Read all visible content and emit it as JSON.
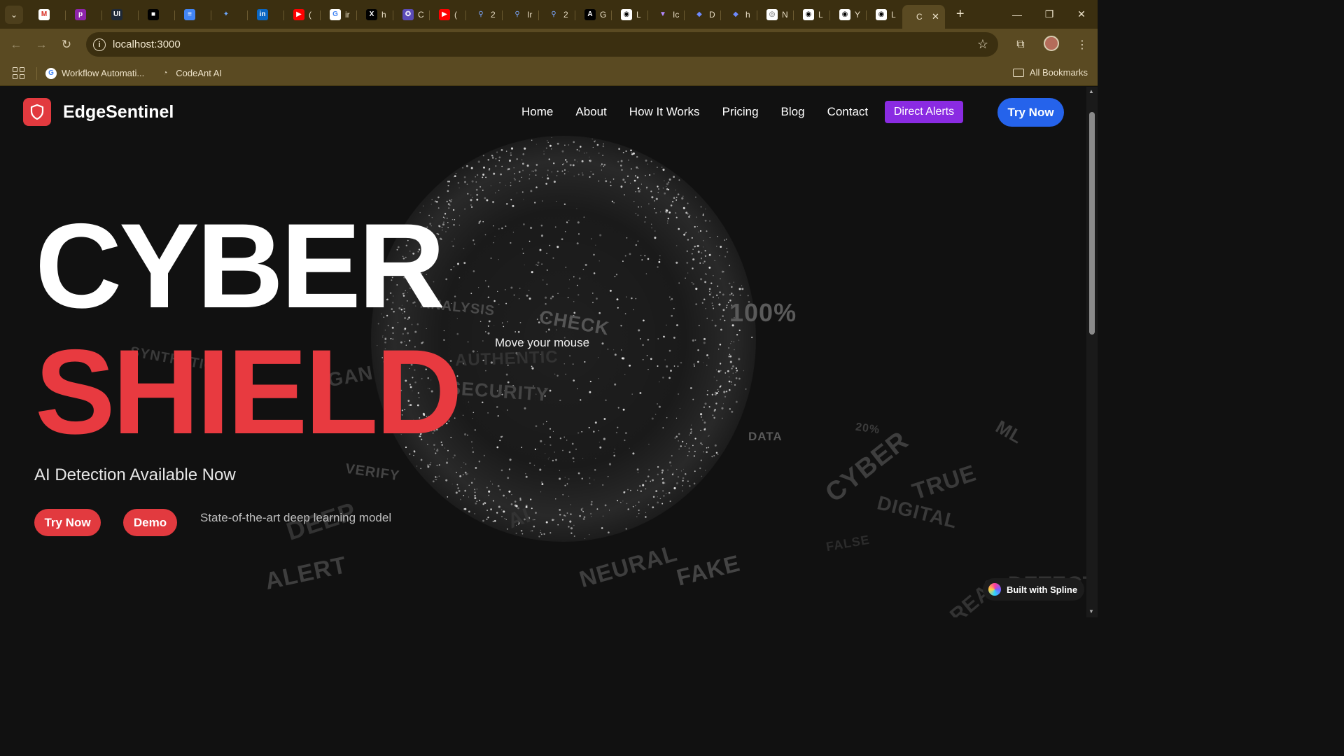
{
  "browser": {
    "tabs": [
      {
        "favicon": "gmail-icon",
        "label": ""
      },
      {
        "favicon": "p-icon",
        "label": ""
      },
      {
        "favicon": "ui-icon",
        "label": ""
      },
      {
        "favicon": "square-icon",
        "label": ""
      },
      {
        "favicon": "docs-icon",
        "label": ""
      },
      {
        "favicon": "gemini-icon",
        "label": ""
      },
      {
        "favicon": "linkedin-icon",
        "label": ""
      },
      {
        "favicon": "youtube-icon",
        "label": "("
      },
      {
        "favicon": "google-icon",
        "label": "ir"
      },
      {
        "favicon": "x-icon",
        "label": "h"
      },
      {
        "favicon": "c-icon",
        "label": "C"
      },
      {
        "favicon": "youtube-icon",
        "label": "("
      },
      {
        "favicon": "search-icon",
        "label": "2"
      },
      {
        "favicon": "search-icon",
        "label": "Ir"
      },
      {
        "favicon": "search-icon",
        "label": "2"
      },
      {
        "favicon": "a-icon",
        "label": "G"
      },
      {
        "favicon": "github-icon",
        "label": "L"
      },
      {
        "favicon": "v-icon",
        "label": "Ic"
      },
      {
        "favicon": "d-icon",
        "label": "D"
      },
      {
        "favicon": "d-icon",
        "label": "h"
      },
      {
        "favicon": "chrome-icon",
        "label": "N"
      },
      {
        "favicon": "github-icon",
        "label": "L"
      },
      {
        "favicon": "github-icon",
        "label": "Y"
      },
      {
        "favicon": "github-icon",
        "label": "L"
      },
      {
        "favicon": "",
        "label": "C"
      }
    ],
    "url": "localhost:3000",
    "bookmarks": [
      {
        "label": "Workflow Automati...",
        "icon": "google-icon"
      },
      {
        "label": "CodeAnt AI",
        "icon": "codeant-icon"
      }
    ],
    "all_bookmarks": "All Bookmarks"
  },
  "site": {
    "brand": "EdgeSentinel",
    "nav": [
      "Home",
      "About",
      "How It Works",
      "Pricing",
      "Blog",
      "Contact"
    ],
    "alerts_button": "Direct Alerts",
    "try_now_top": "Try Now",
    "hero_line1": "CYBER",
    "hero_line2": "SHIELD",
    "hint": "Move your mouse",
    "subtitle": "AI Detection Available Now",
    "try_now": "Try Now",
    "demo": "Demo",
    "tagline": "State-of-the-art deep learning model",
    "spline_badge": "Built with Spline",
    "floating_words": [
      "ANALYSIS",
      "CHECK",
      "100%",
      "SYNTHETIC",
      "GAN",
      "SECURITY",
      "AUTHENTIC",
      "DATA",
      "20%",
      "ML",
      "CYBER",
      "TRUE",
      "DIGITAL",
      "VERIFY",
      "DEEP",
      "ALERT",
      "NEURAL",
      "FAKE",
      "REAL",
      "DETECTION",
      "AI",
      "FALSE"
    ],
    "colors": {
      "accent_red": "#e23a3f",
      "alerts_purple": "#8a2be2",
      "cta_blue": "#2563eb"
    }
  }
}
